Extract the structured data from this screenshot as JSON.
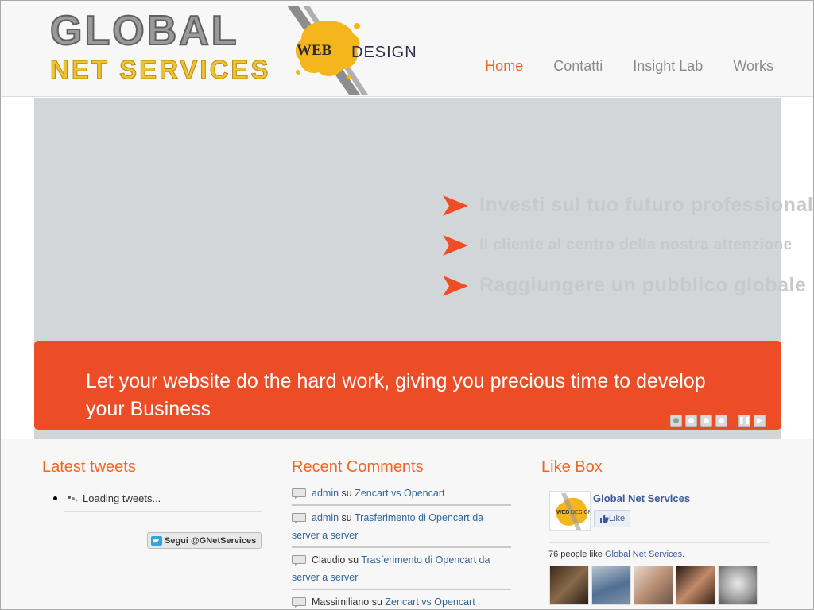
{
  "logo": {
    "line1": "GLOBAL",
    "line2": "NET SERVICES",
    "badge_web": "WEB",
    "badge_design": "DESIGN"
  },
  "nav": {
    "items": [
      {
        "label": "Home",
        "active": true
      },
      {
        "label": "Contatti",
        "active": false
      },
      {
        "label": "Insight Lab",
        "active": false
      },
      {
        "label": "Works",
        "active": false
      }
    ]
  },
  "slider": {
    "bullets": [
      "Investi sul tuo futuro professionale",
      "Il cliente al centro della nostra attenzione",
      "Raggiungere un pubblico globale"
    ],
    "caption": "Let your website do the hard work, giving you precious time to develop your Business",
    "slide_count": 4,
    "active_slide": 1,
    "controls": {
      "pause_icon": "pause-icon",
      "play_icon": "play-icon"
    }
  },
  "tweets": {
    "title": "Latest tweets",
    "loading": "Loading tweets...",
    "follow_label": "Segui @GNetServices"
  },
  "comments": {
    "title": "Recent Comments",
    "connector": "su",
    "items": [
      {
        "author": "admin",
        "post": "Zencart vs Opencart"
      },
      {
        "author": "admin",
        "post": "Trasferimento di Opencart da server a server"
      },
      {
        "author": "Claudio",
        "post": "Trasferimento di Opencart da server a server"
      },
      {
        "author": "Massimiliano",
        "post": "Zencart vs Opencart"
      }
    ]
  },
  "likebox": {
    "title": "Like Box",
    "page_name": "Global Net Services",
    "like_label": "Like",
    "count_text": "76 people like",
    "count_link": "Global Net Services",
    "count_suffix": "."
  },
  "colors": {
    "accent": "#f26522",
    "caption_bg": "#ec4d27",
    "slider_bg": "#d3d6d8",
    "link": "#336699",
    "facebook": "#3b5998"
  }
}
